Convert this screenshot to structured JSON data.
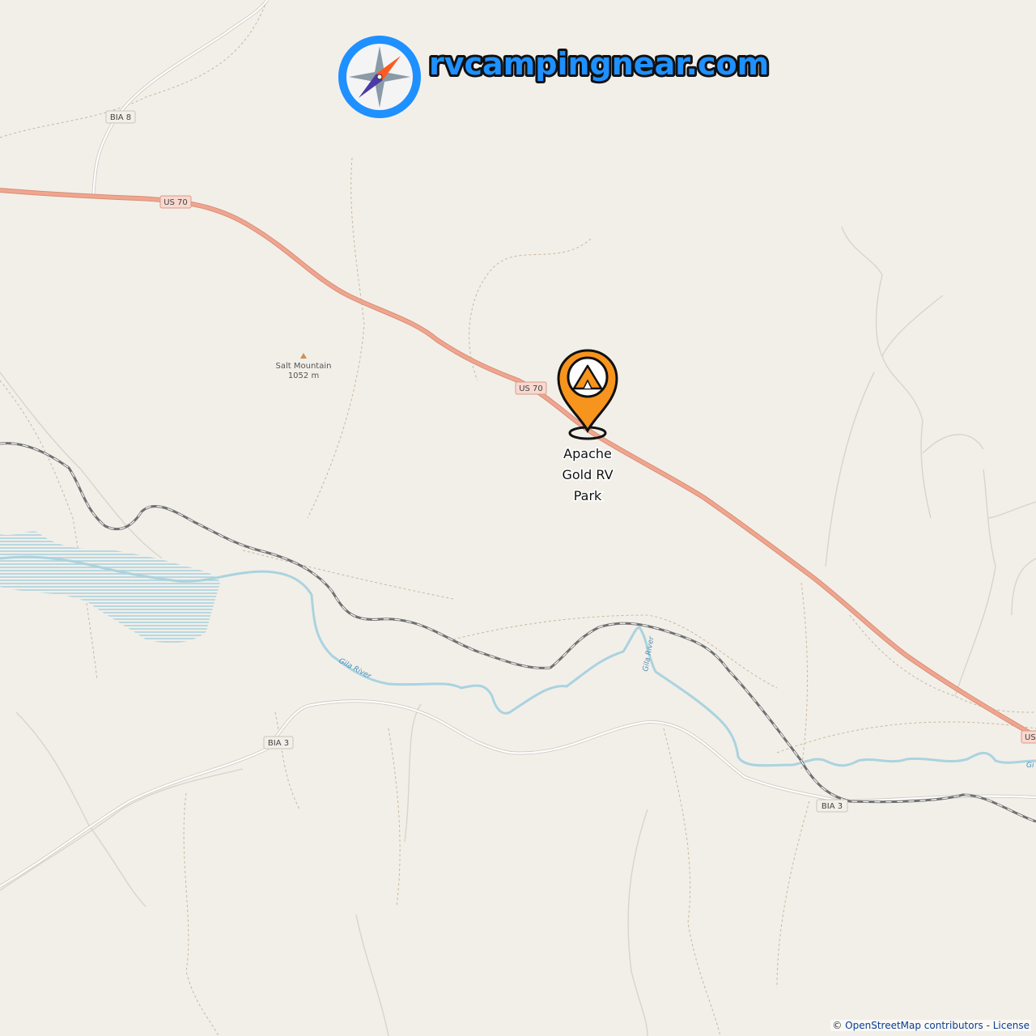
{
  "brand": {
    "site_name": "rvcampingnear.com",
    "logo_icon": "compass-icon"
  },
  "marker": {
    "name_line1": "Apache",
    "name_line2": "Gold RV",
    "name_line3": "Park",
    "icon": "campground-tent-pin-icon",
    "color": "#f7941d"
  },
  "peak": {
    "name": "Salt Mountain",
    "elevation": "1052 m"
  },
  "roads": {
    "us70": "US 70",
    "us70_edge": "US",
    "bia8": "BIA 8",
    "bia3_west": "BIA 3",
    "bia3_east": "BIA 3"
  },
  "rivers": {
    "gila_1": "Gila River",
    "gila_2": "Gila River",
    "gila_edge": "Gi"
  },
  "attribution": {
    "copyright": "©",
    "osm_link": "OpenStreetMap contributors",
    "separator": " - ",
    "license_link": "License"
  },
  "colors": {
    "background": "#f2efe9",
    "highway": "#eb9b82",
    "water": "#aad3df",
    "rail": "#777777",
    "brand_blue": "#1e90ff"
  }
}
